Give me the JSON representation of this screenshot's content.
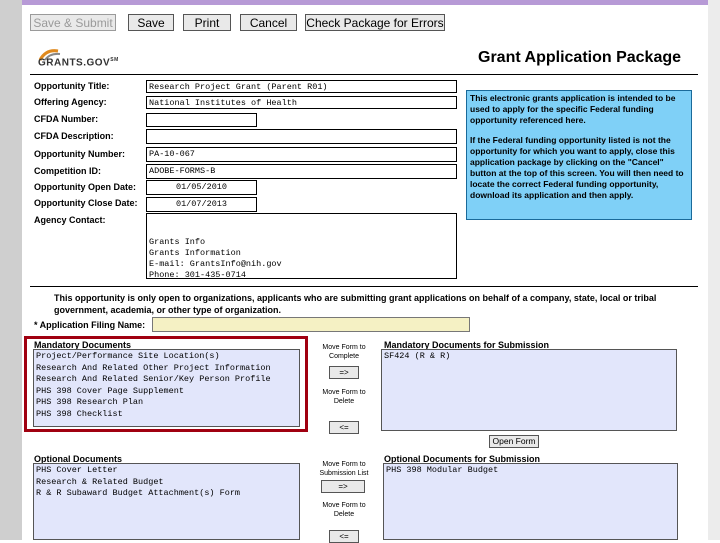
{
  "toolbar": {
    "save_submit": "Save & Submit",
    "save": "Save",
    "print": "Print",
    "cancel": "Cancel",
    "check_errors": "Check Package for Errors"
  },
  "header": {
    "logo_text": "GRANTS.GOV",
    "logo_tm": "SM",
    "title": "Grant Application Package"
  },
  "form": {
    "opportunity_title_label": "Opportunity Title:",
    "opportunity_title": "Research Project Grant (Parent R01)",
    "offering_agency_label": "Offering Agency:",
    "offering_agency": "National Institutes of Health",
    "cfda_number_label": "CFDA Number:",
    "cfda_number": "",
    "cfda_description_label": "CFDA Description:",
    "cfda_description": "",
    "opportunity_number_label": "Opportunity Number:",
    "opportunity_number": "PA-10-067",
    "competition_id_label": "Competition ID:",
    "competition_id": "ADOBE-FORMS-B",
    "open_date_label": "Opportunity Open Date:",
    "open_date": "01/05/2010",
    "close_date_label": "Opportunity Close Date:",
    "close_date": "01/07/2013",
    "agency_contact_label": "Agency Contact:",
    "agency_contact": [
      "Grants Info",
      "Grants Information",
      "E-mail: GrantsInfo@nih.gov",
      "Phone: 301-435-0714"
    ]
  },
  "info_box": {
    "p1": "This electronic grants application is intended to be used to apply for the specific Federal funding opportunity referenced here.",
    "p2": "If the Federal funding opportunity listed is not the opportunity for which you want to apply, close this application package by clicking on the \"Cancel\" button at the top of this screen. You will then need to locate the correct Federal funding opportunity, download its application and then apply."
  },
  "notice": "This opportunity is only open to organizations, applicants who are submitting grant applications on behalf of a company, state, local or tribal government, academia, or other type of organization.",
  "filing_name_label": "* Application Filing Name:",
  "filing_name": "",
  "mandatory": {
    "heading": "Mandatory Documents",
    "items": [
      "Project/Performance Site Location(s)",
      "Research And Related Other Project Information",
      "Research And Related Senior/Key Person Profile",
      "PHS 398 Cover Page Supplement",
      "PHS 398 Research Plan",
      "PHS 398 Checklist"
    ],
    "move_complete_label": "Move Form to Complete",
    "move_complete_btn": "=>",
    "move_delete_label": "Move Form to Delete",
    "move_delete_btn": "<=",
    "submission_heading": "Mandatory Documents for Submission",
    "submission_items": [
      "SF424 (R & R)"
    ],
    "open_form": "Open Form"
  },
  "optional": {
    "heading": "Optional Documents",
    "items": [
      "PHS Cover Letter",
      "Research & Related Budget",
      "R & R Subaward Budget Attachment(s) Form"
    ],
    "move_submission_label": "Move Form to Submission List",
    "move_submission_btn": "=>",
    "move_delete_label": "Move Form to Delete",
    "move_delete_btn": "<=",
    "submission_heading": "Optional Documents for Submission",
    "submission_items": [
      "PHS 398 Modular Budget"
    ]
  },
  "colors": {
    "info_bg": "#7fd0f7",
    "list_bg": "#e2e6fb",
    "filing_bg": "#f5f1c4",
    "highlight": "#a00010"
  }
}
